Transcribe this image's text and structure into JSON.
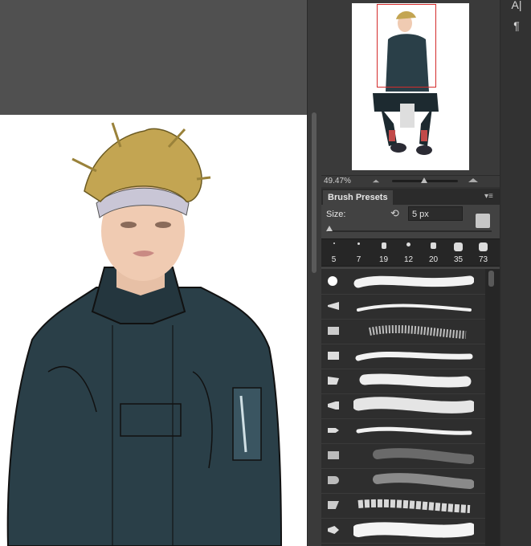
{
  "navigator": {
    "zoom": "49.47%"
  },
  "brush_presets": {
    "tab_label": "Brush Presets",
    "menu_icon": "panel-menu-icon",
    "size_label": "Size:",
    "size_value": "5 px",
    "size_fraction": 0.01,
    "thumbnails": [
      {
        "size": "5"
      },
      {
        "size": "7"
      },
      {
        "size": "19"
      },
      {
        "size": "12"
      },
      {
        "size": "20"
      },
      {
        "size": "35"
      },
      {
        "size": "73"
      }
    ]
  },
  "tools": {
    "character_icon": "A|",
    "paragraph_icon": "¶"
  },
  "colors": {
    "jacket": "#2a3f48",
    "hair": "#c3a552",
    "selection_frame": "#d42c2c"
  }
}
